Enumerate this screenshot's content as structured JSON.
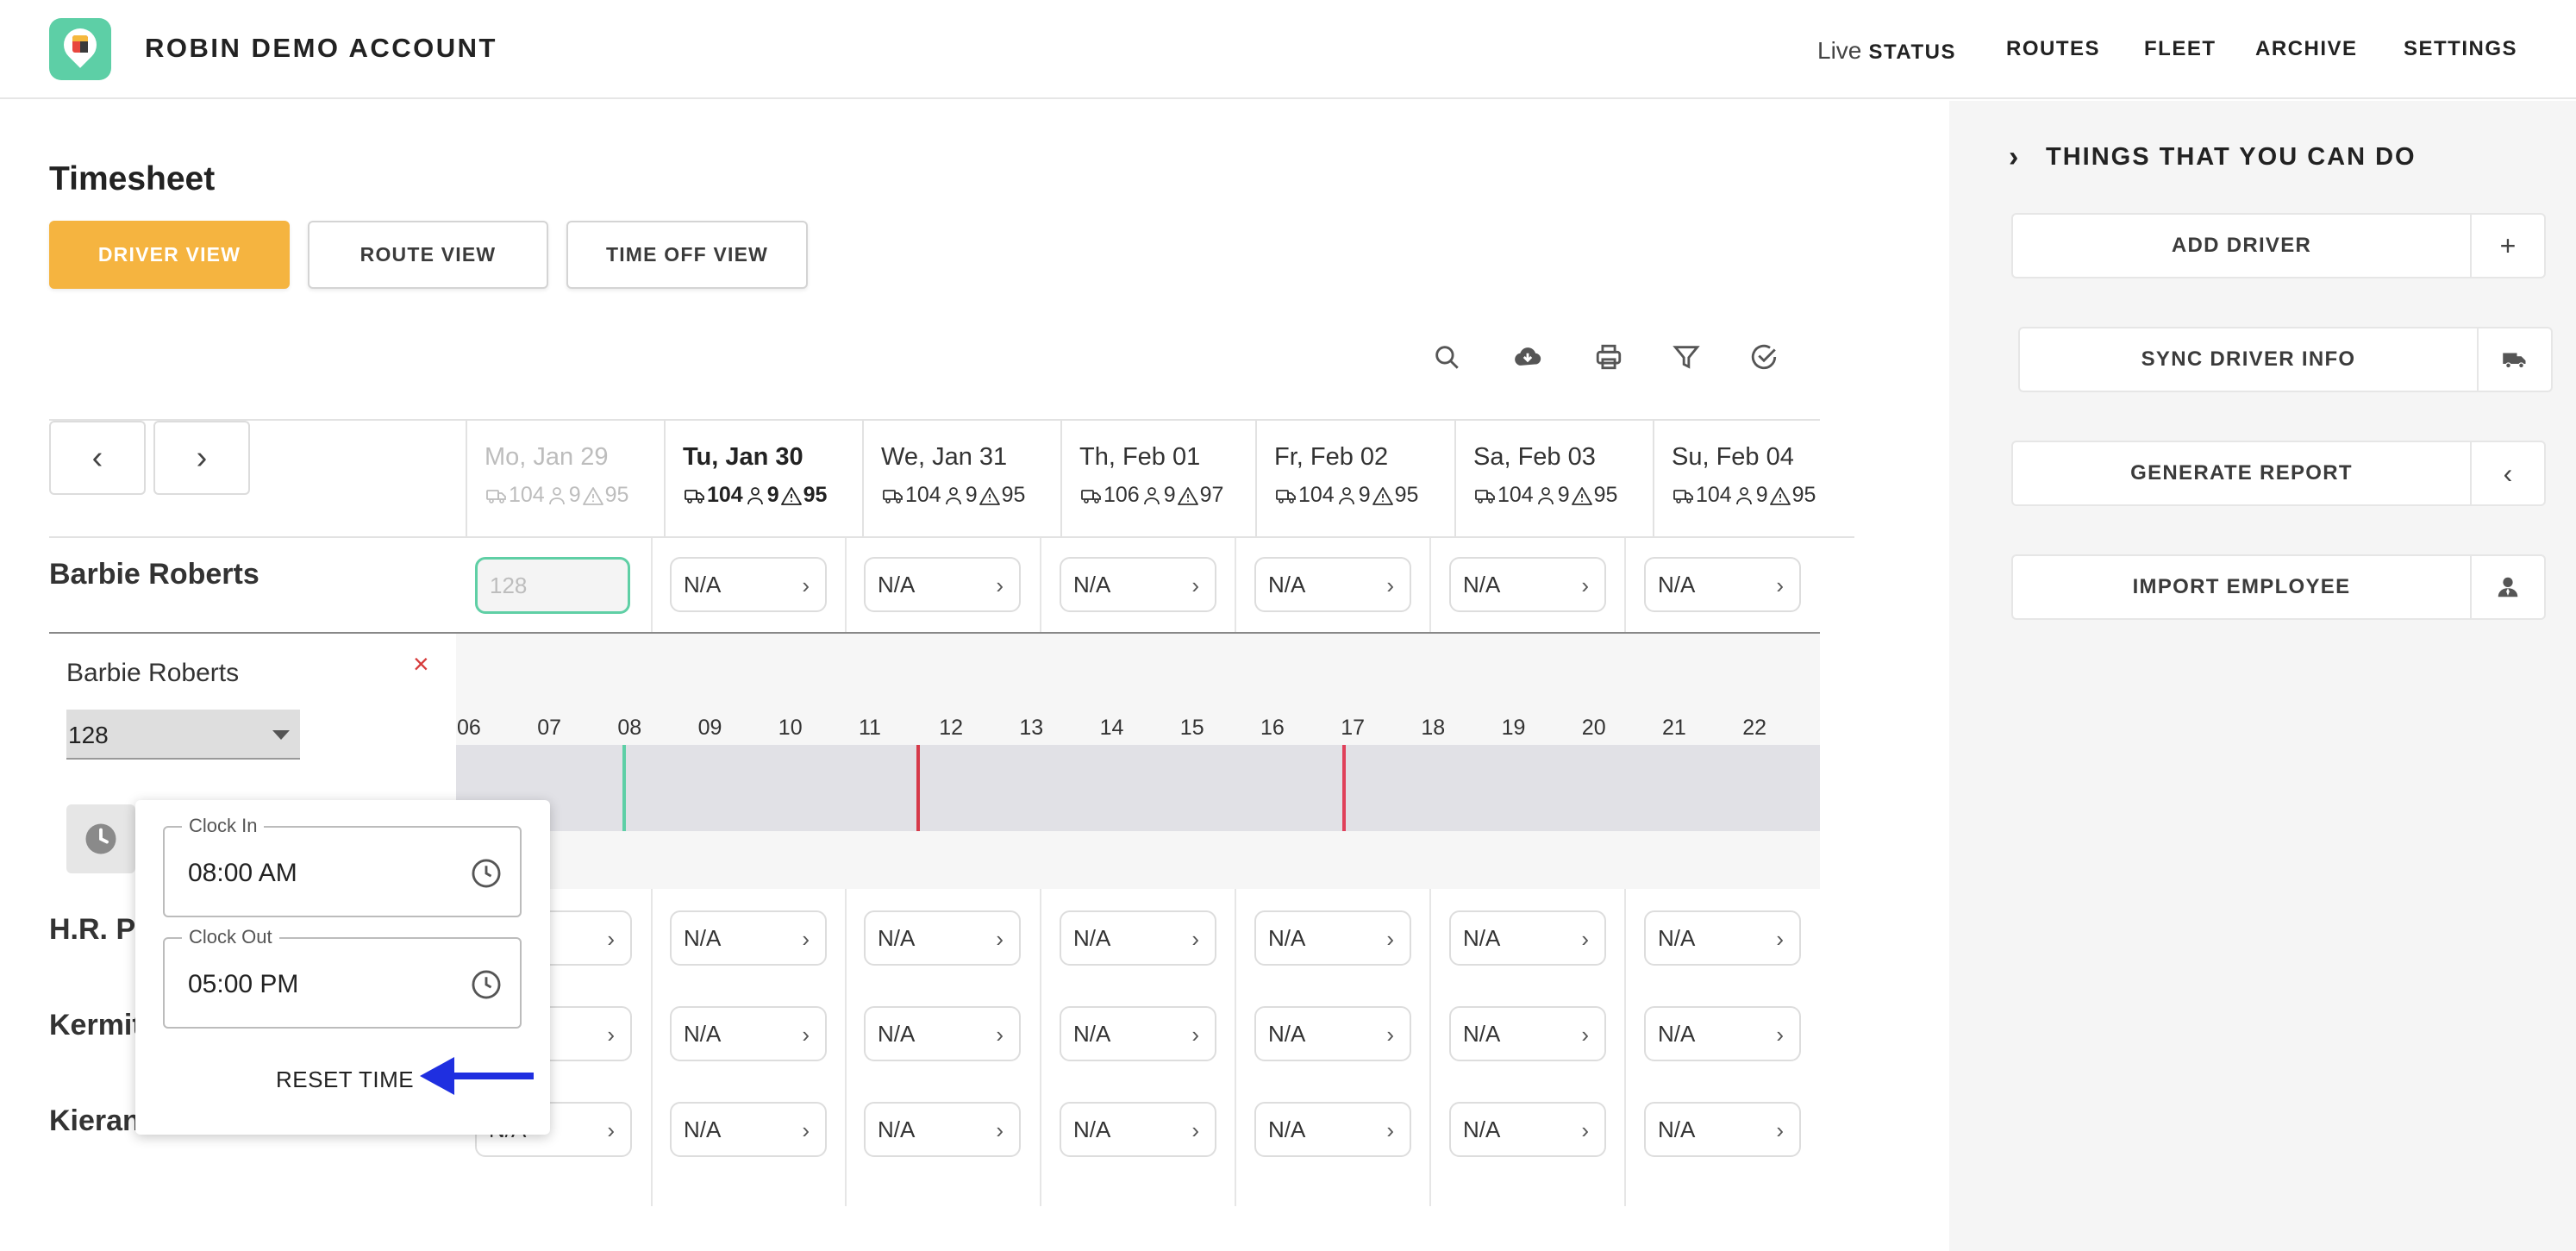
{
  "header": {
    "app_title": "ROBIN DEMO ACCOUNT",
    "nav": {
      "live_prefix": "Live",
      "status": "STATUS",
      "routes": "ROUTES",
      "fleet": "FLEET",
      "archive": "ARCHIVE",
      "settings": "SETTINGS"
    }
  },
  "page": {
    "title": "Timesheet",
    "views": [
      "DRIVER VIEW",
      "ROUTE VIEW",
      "TIME OFF VIEW"
    ],
    "active_view": "DRIVER VIEW"
  },
  "toolbar_icons": [
    "search-icon",
    "cloud-download-icon",
    "print-icon",
    "filter-icon",
    "check-circle-icon"
  ],
  "nav_arrows": {
    "prev": "‹",
    "next": "›"
  },
  "days": [
    {
      "label": "Mo, Jan 29",
      "vehicles": "104",
      "drivers": "9",
      "alerts": "95",
      "style": "muted"
    },
    {
      "label": "Tu, Jan 30",
      "vehicles": "104",
      "drivers": "9",
      "alerts": "95",
      "style": "bold"
    },
    {
      "label": "We, Jan 31",
      "vehicles": "104",
      "drivers": "9",
      "alerts": "95",
      "style": "normal"
    },
    {
      "label": "Th, Feb 01",
      "vehicles": "106",
      "drivers": "9",
      "alerts": "97",
      "style": "normal"
    },
    {
      "label": "Fr, Feb 02",
      "vehicles": "104",
      "drivers": "9",
      "alerts": "95",
      "style": "normal"
    },
    {
      "label": "Sa, Feb 03",
      "vehicles": "104",
      "drivers": "9",
      "alerts": "95",
      "style": "normal"
    },
    {
      "label": "Su, Feb 04",
      "vehicles": "104",
      "drivers": "9",
      "alerts": "95",
      "style": "normal"
    }
  ],
  "rows": [
    {
      "name": "Barbie Roberts",
      "cells": [
        "128",
        "N/A",
        "N/A",
        "N/A",
        "N/A",
        "N/A",
        "N/A"
      ]
    },
    {
      "name": "H.R. Pu",
      "cells": [
        "",
        "N/A",
        "N/A",
        "N/A",
        "N/A",
        "N/A",
        "N/A"
      ]
    },
    {
      "name": "Kermit",
      "cells": [
        "",
        "N/A",
        "N/A",
        "N/A",
        "N/A",
        "N/A",
        "N/A"
      ]
    },
    {
      "name": "Kieran",
      "cells": [
        "N/A",
        "N/A",
        "N/A",
        "N/A",
        "N/A",
        "N/A",
        "N/A"
      ]
    }
  ],
  "cell_chevron": "›",
  "expanded": {
    "driver_name": "Barbie Roberts",
    "close_glyph": "×",
    "vehicle_select": "128",
    "hours": [
      "06",
      "07",
      "08",
      "09",
      "10",
      "11",
      "12",
      "13",
      "14",
      "15",
      "16",
      "17",
      "18",
      "19",
      "20",
      "21",
      "22"
    ],
    "markers": [
      {
        "hour": 8.0,
        "color": "#5dcfa6"
      },
      {
        "hour": 11.65,
        "color": "#d63a4a"
      },
      {
        "hour": 16.95,
        "color": "#e0405a"
      }
    ]
  },
  "clock_popup": {
    "clock_in_label": "Clock In",
    "clock_in_value": "08:00 AM",
    "clock_out_label": "Clock Out",
    "clock_out_value": "05:00 PM",
    "reset_label": "RESET TIME",
    "arrow_color": "#1f2fe0"
  },
  "sidebar": {
    "chevron": "›",
    "title": "THINGS THAT YOU CAN DO",
    "actions": [
      {
        "label": "ADD DRIVER",
        "icon": "plus-icon",
        "glyph": "+"
      },
      {
        "label": "SYNC DRIVER INFO",
        "icon": "truck-icon",
        "glyph": ""
      },
      {
        "label": "GENERATE REPORT",
        "icon": "chevron-left-icon",
        "glyph": "‹"
      },
      {
        "label": "IMPORT EMPLOYEE",
        "icon": "user-icon",
        "glyph": ""
      }
    ]
  },
  "colors": {
    "accent": "#f5b440",
    "brand": "#5dcfa6",
    "close": "#d63a3a"
  }
}
